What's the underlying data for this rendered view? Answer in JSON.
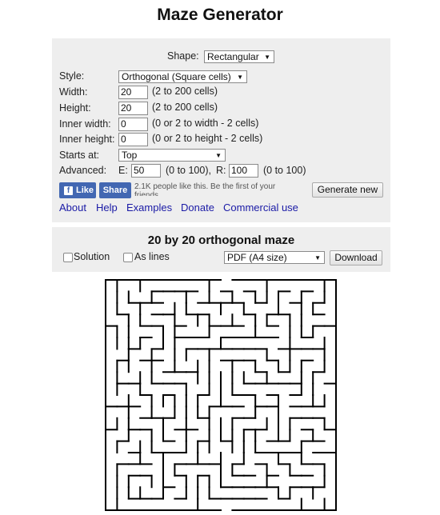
{
  "page": {
    "title": "Maze Generator"
  },
  "settings": {
    "shape_label": "Shape:",
    "shape_value": "Rectangular",
    "style_label": "Style:",
    "style_value": "Orthogonal (Square cells)",
    "width_label": "Width:",
    "width_value": "20",
    "width_hint": "(2 to 200 cells)",
    "height_label": "Height:",
    "height_value": "20",
    "height_hint": "(2 to 200 cells)",
    "inner_width_label": "Inner width:",
    "inner_width_value": "0",
    "inner_width_hint": "(0 or 2 to width - 2 cells)",
    "inner_height_label": "Inner height:",
    "inner_height_value": "0",
    "inner_height_hint": "(0 or 2 to height - 2 cells)",
    "starts_at_label": "Starts at:",
    "starts_at_value": "Top",
    "advanced_label": "Advanced:",
    "e_label": "E:",
    "e_value": "50",
    "e_hint": "(0 to 100),",
    "r_label": "R:",
    "r_value": "100",
    "r_hint": "(0 to 100)",
    "fb_like": "Like",
    "fb_share": "Share",
    "fb_text_line1": "2.1K people like this. Be the first of your",
    "fb_text_line2": "friends.",
    "generate_label": "Generate new",
    "links": [
      "About",
      "Help",
      "Examples",
      "Donate",
      "Commercial use"
    ]
  },
  "maze_panel": {
    "heading": "20 by 20 orthogonal maze",
    "solution_label": "Solution",
    "as_lines_label": "As lines",
    "format_value": "PDF (A4 size)",
    "download_label": "Download"
  },
  "maze": {
    "cols": 20,
    "rows": 20,
    "entrance": "top",
    "exit": "bottom"
  }
}
